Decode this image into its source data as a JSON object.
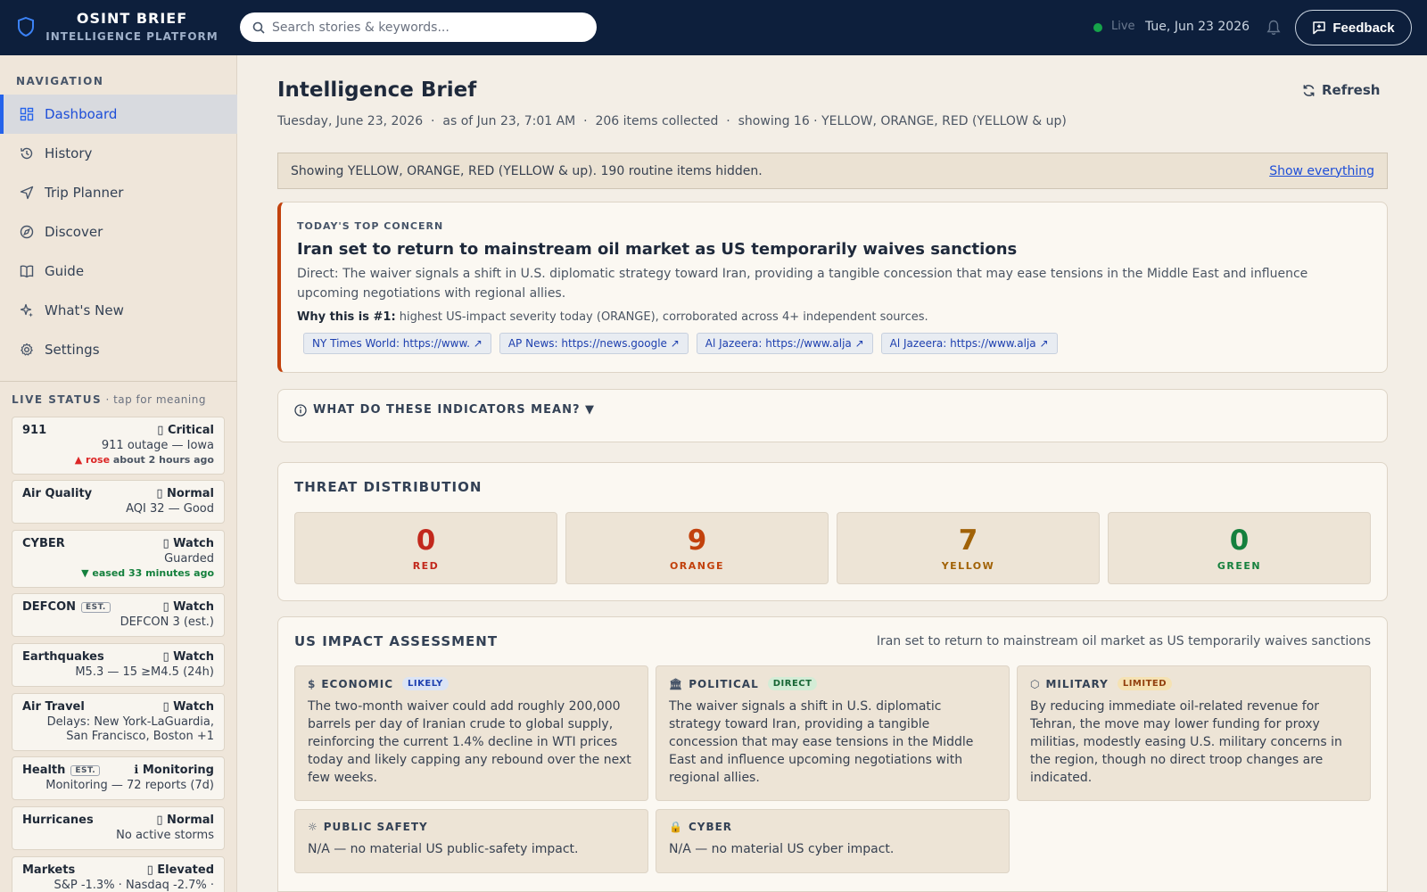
{
  "header": {
    "brand_title": "OSINT BRIEF",
    "brand_subtitle": "INTELLIGENCE PLATFORM",
    "search_placeholder": "Search stories & keywords...",
    "live_label": "Live",
    "date": "Tue, Jun 23 2026",
    "feedback_label": "Feedback"
  },
  "sidebar": {
    "nav_heading": "NAVIGATION",
    "items": [
      {
        "label": "Dashboard",
        "icon": "grid-icon",
        "active": true
      },
      {
        "label": "History",
        "icon": "history-icon"
      },
      {
        "label": "Trip Planner",
        "icon": "send-icon"
      },
      {
        "label": "Discover",
        "icon": "compass-icon"
      },
      {
        "label": "Guide",
        "icon": "book-icon"
      },
      {
        "label": "What's New",
        "icon": "sparkle-icon"
      },
      {
        "label": "Settings",
        "icon": "gear-icon"
      }
    ],
    "status_heading": "LIVE STATUS",
    "status_hint": "· tap for meaning",
    "status_cards": [
      {
        "name": "911",
        "level": "▯ Critical",
        "detail": "911 outage — Iowa",
        "trend_dir": "▲ rose",
        "trend_text": " about 2 hours ago"
      },
      {
        "name": "Air Quality",
        "level": "▯ Normal",
        "detail": "AQI 32 — Good"
      },
      {
        "name": "CYBER",
        "level": "▯ Watch",
        "detail": "Guarded",
        "trend_dir": "▼ eased",
        "trend_text": " 33 minutes ago"
      },
      {
        "name": "DEFCON",
        "est": "EST.",
        "level": "▯ Watch",
        "detail": "DEFCON 3 (est.)"
      },
      {
        "name": "Earthquakes",
        "level": "▯ Watch",
        "detail": "M5.3 — 15 ≥M4.5 (24h)"
      },
      {
        "name": "Air Travel",
        "level": "▯ Watch",
        "detail": "Delays: New York-LaGuardia, San Francisco, Boston +1"
      },
      {
        "name": "Health",
        "est": "EST.",
        "level": "ℹ Monitoring",
        "detail": "Monitoring — 72 reports (7d)"
      },
      {
        "name": "Hurricanes",
        "level": "▯ Normal",
        "detail": "No active storms"
      },
      {
        "name": "Markets",
        "level": "▯ Elevated",
        "detail": "S&P -1.3% · Nasdaq -2.7% ·"
      }
    ]
  },
  "main": {
    "title": "Intelligence Brief",
    "subtitle": "Tuesday, June 23, 2026  ·  as of Jun 23, 7:01 AM  ·  206 items collected  ·  showing 16 · YELLOW, ORANGE, RED (YELLOW & up)",
    "refresh_label": "Refresh",
    "filter_text": "Showing YELLOW, ORANGE, RED (YELLOW & up). 190 routine items hidden.",
    "show_everything_label": "Show everything",
    "top_concern": {
      "label": "TODAY'S TOP CONCERN",
      "title": "Iran set to return to mainstream oil market as US temporarily waives sanctions",
      "description": "Direct: The waiver signals a shift in U.S. diplomatic strategy toward Iran, providing a tangible concession that may ease tensions in the Middle East and influence upcoming negotiations with regional allies.",
      "why_label": "Why this is #1:",
      "why_text": " highest US-impact severity today (ORANGE), corroborated across 4+ independent sources.",
      "sources": [
        "NY Times World: https://www. ↗",
        "AP News: https://news.google ↗",
        "Al Jazeera: https://www.alja ↗",
        "Al Jazeera: https://www.alja ↗"
      ]
    },
    "indicators_label": "WHAT DO THESE INDICATORS MEAN? ▼",
    "threat": {
      "title": "THREAT DISTRIBUTION",
      "levels": [
        {
          "count": "0",
          "label": "RED",
          "color": "#c2281c"
        },
        {
          "count": "9",
          "label": "ORANGE",
          "color": "#c2410c"
        },
        {
          "count": "7",
          "label": "YELLOW",
          "color": "#a16207"
        },
        {
          "count": "0",
          "label": "GREEN",
          "color": "#15803d"
        }
      ]
    },
    "impact": {
      "title": "US IMPACT ASSESSMENT",
      "reference": "Iran set to return to mainstream oil market as US temporarily waives sanctions",
      "cards": [
        {
          "icon": "$",
          "label": "ECONOMIC",
          "badge": "LIKELY",
          "badge_bg": "#dbe4f5",
          "badge_fg": "#1e40af",
          "text": "The two-month waiver could add roughly 200,000 barrels per day of Iranian crude to global supply, reinforcing the current 1.4% decline in WTI prices today and likely capping any rebound over the next few weeks."
        },
        {
          "icon": "🏛",
          "label": "POLITICAL",
          "badge": "DIRECT",
          "badge_bg": "#d3ecd6",
          "badge_fg": "#166534",
          "text": "The waiver signals a shift in U.S. diplomatic strategy toward Iran, providing a tangible concession that may ease tensions in the Middle East and influence upcoming negotiations with regional allies."
        },
        {
          "icon": "⬡",
          "label": "MILITARY",
          "badge": "LIMITED",
          "badge_bg": "#f5e2b3",
          "badge_fg": "#92400e",
          "text": "By reducing immediate oil-related revenue for Tehran, the move may lower funding for proxy militias, modestly easing U.S. military concerns in the region, though no direct troop changes are indicated."
        },
        {
          "icon": "☼",
          "label": "PUBLIC SAFETY",
          "text": "N/A — no material US public-safety impact."
        },
        {
          "icon": "🔒",
          "label": "CYBER",
          "text": "N/A — no material US cyber impact."
        }
      ]
    }
  }
}
